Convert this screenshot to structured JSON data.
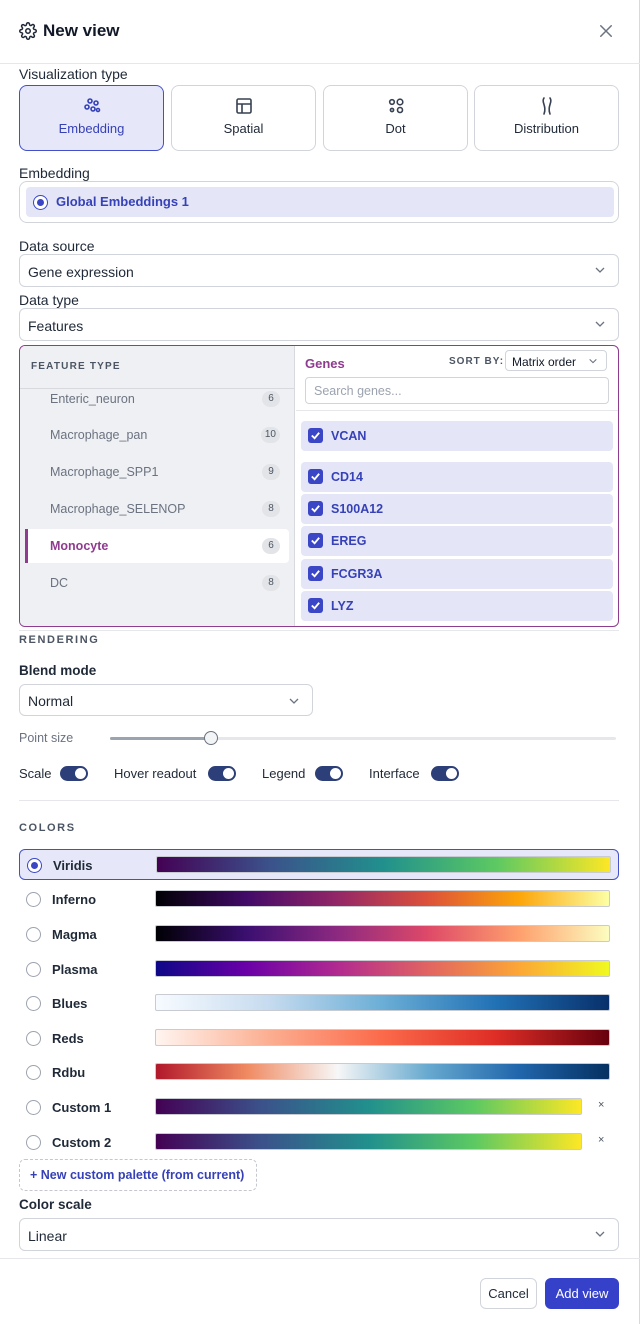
{
  "dialog": {
    "title": "New view",
    "icons": {
      "title": "gear-icon",
      "close": "close-icon"
    }
  },
  "visualization": {
    "label": "Visualization type",
    "options": [
      {
        "label": "Embedding",
        "icon": "scatter-dots-icon",
        "selected": true
      },
      {
        "label": "Spatial",
        "icon": "grid-layout-icon",
        "selected": false
      },
      {
        "label": "Dot",
        "icon": "dot-grid-icon",
        "selected": false
      },
      {
        "label": "Distribution",
        "icon": "violin-icon",
        "selected": false
      }
    ]
  },
  "embedding": {
    "label": "Embedding",
    "selected": "Global Embeddings 1"
  },
  "data_source": {
    "label": "Data source",
    "value": "Gene expression"
  },
  "data_type": {
    "label": "Data type",
    "value": "Features"
  },
  "feature_panel": {
    "header": "FEATURE TYPE",
    "items": [
      {
        "name": "Enteric_neuron",
        "count": "6"
      },
      {
        "name": "Macrophage_pan",
        "count": "10"
      },
      {
        "name": "Macrophage_SPP1",
        "count": "9"
      },
      {
        "name": "Macrophage_SELENOP",
        "count": "8"
      },
      {
        "name": "Monocyte",
        "count": "6",
        "selected": true
      },
      {
        "name": "DC",
        "count": "8"
      }
    ],
    "genes_title": "Genes",
    "sort_label": "SORT BY:",
    "sort_value": "Matrix order",
    "search_placeholder": "Search genes...",
    "genes": [
      "VCAN",
      "CD14",
      "S100A12",
      "EREG",
      "FCGR3A",
      "LYZ"
    ]
  },
  "rendering": {
    "header": "RENDERING",
    "blend_label": "Blend mode",
    "blend_value": "Normal",
    "point_size_label": "Point size",
    "point_size_fraction": 0.2,
    "toggles": [
      {
        "label": "Scale",
        "on": true
      },
      {
        "label": "Hover readout",
        "on": true
      },
      {
        "label": "Legend",
        "on": true
      },
      {
        "label": "Interface",
        "on": true
      }
    ]
  },
  "colors": {
    "header": "COLORS",
    "palettes": [
      {
        "name": "Viridis",
        "selected": true,
        "stops": [
          "#440154",
          "#3b528b",
          "#21908d",
          "#5dc962",
          "#fde725"
        ]
      },
      {
        "name": "Inferno",
        "stops": [
          "#000004",
          "#420a68",
          "#932667",
          "#dd513a",
          "#fca50a",
          "#fcffa4"
        ]
      },
      {
        "name": "Magma",
        "stops": [
          "#000004",
          "#3b0f70",
          "#8c2981",
          "#de4968",
          "#fe9f6d",
          "#fcfdbf"
        ]
      },
      {
        "name": "Plasma",
        "stops": [
          "#0d0887",
          "#6a00a8",
          "#b12a90",
          "#e16462",
          "#fca636",
          "#f0f921"
        ]
      },
      {
        "name": "Blues",
        "stops": [
          "#f7fbff",
          "#c6dbef",
          "#6baed6",
          "#2171b5",
          "#08306b"
        ]
      },
      {
        "name": "Reds",
        "stops": [
          "#fff5f0",
          "#fcae91",
          "#fb6a4a",
          "#de2d26",
          "#67000d"
        ]
      },
      {
        "name": "Rdbu",
        "stops": [
          "#b2182b",
          "#ef8a62",
          "#f7f7f7",
          "#67a9cf",
          "#2166ac",
          "#053061"
        ]
      },
      {
        "name": "Custom 1",
        "custom": true,
        "stops": [
          "#440154",
          "#3b528b",
          "#21908d",
          "#5dc962",
          "#fde725"
        ]
      },
      {
        "name": "Custom 2",
        "custom": true,
        "stops": [
          "#440154",
          "#3b528b",
          "#21908d",
          "#5dc962",
          "#fde725"
        ]
      }
    ],
    "remove_label": "×",
    "new_palette": "+ New custom palette (from current)",
    "scale_label": "Color scale",
    "scale_value": "Linear"
  },
  "footer": {
    "cancel": "Cancel",
    "add": "Add view"
  }
}
